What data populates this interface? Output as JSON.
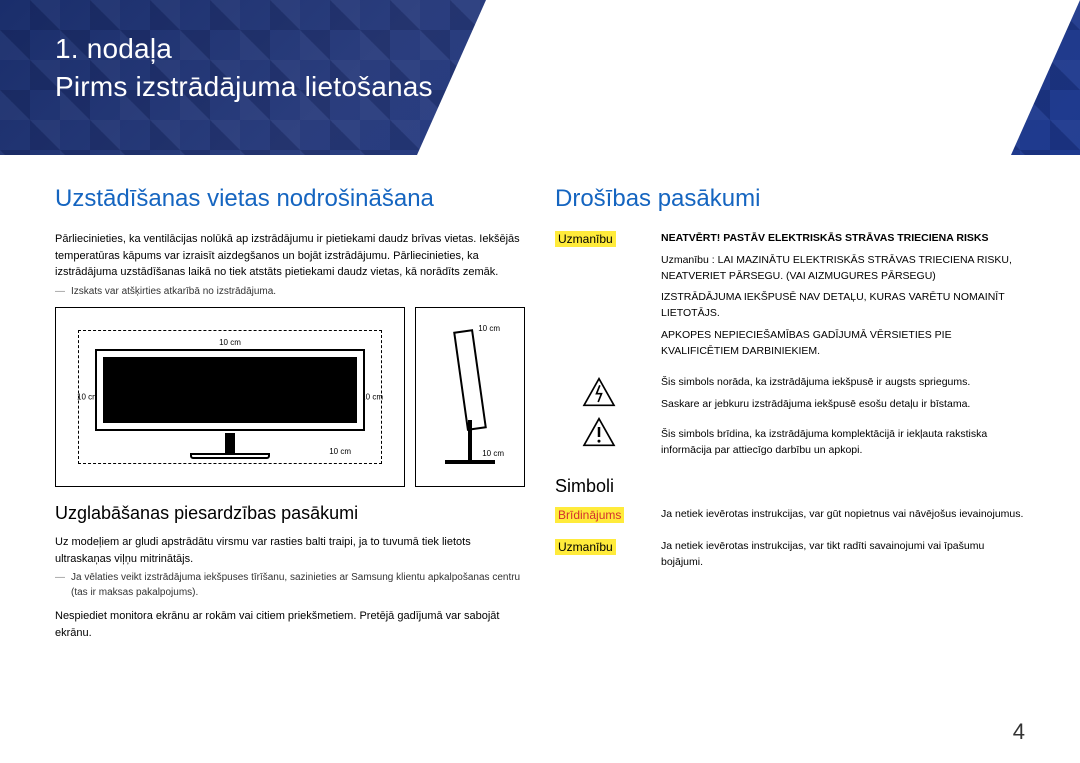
{
  "header": {
    "chapter_label": "1. nodaļa",
    "chapter_title": "Pirms izstrādājuma lietošanas"
  },
  "left": {
    "heading": "Uzstādīšanas vietas nodrošināšana",
    "intro": "Pārliecinieties, ka ventilācijas nolūkā ap izstrādājumu ir pietiekami daudz brīvas vietas. Iekšējās temperatūras kāpums var izraisīt aizdegšanos un bojāt izstrādājumu. Pārliecinieties, ka izstrādājuma uzstādīšanas laikā no tiek atstāts pietiekami daudz vietas, kā norādīts zemāk.",
    "note1": "Izskats var atšķirties atkarībā no izstrādājuma.",
    "dim_10cm": "10 cm",
    "storage_heading": "Uzglabāšanas piesardzības pasākumi",
    "storage_p1": "Uz modeļiem ar gludi apstrādātu virsmu var rasties balti traipi, ja to tuvumā tiek lietots ultraskaņas viļņu mitrinātājs.",
    "storage_note": "Ja vēlaties veikt izstrādājuma iekšpuses tīrīšanu, sazinieties ar Samsung klientu apkalpošanas centru (tas ir maksas pakalpojums).",
    "storage_p2": "Nespiediet monitora ekrānu ar rokām vai citiem priekšmetiem. Pretējā gadījumā var sabojāt ekrānu."
  },
  "right": {
    "heading": "Drošības pasākumi",
    "caution_label": "Uzmanību",
    "caution_bold": "NEATVĒRT! PASTĀV ELEKTRISKĀS STRĀVAS TRIECIENA RISKS",
    "caution_p1": "Uzmanību : LAI MAZINĀTU ELEKTRISKĀS STRĀVAS TRIECIENA RISKU, NEATVERIET PĀRSEGU. (VAI AIZMUGURES PĀRSEGU)",
    "caution_p2": "IZSTRĀDĀJUMA IEKŠPUSĒ NAV DETAĻU, KURAS VARĒTU NOMAINĪT LIETOTĀJS.",
    "caution_p3": "APKOPES NEPIECIEŠAMĪBAS GADĪJUMĀ VĒRSIETIES PIE KVALIFICĒTIEM DARBINIEKIEM.",
    "shock_p1": "Šis simbols norāda, ka izstrādājuma iekšpusē ir augsts spriegums.",
    "shock_p2": "Saskare ar jebkuru izstrādājuma iekšpusē esošu detaļu ir bīstama.",
    "excl_p1": "Šis simbols brīdina, ka izstrādājuma komplektācijā ir iekļauta rakstiska informācija par attiecīgo darbību un apkopi.",
    "symbols_heading": "Simboli",
    "warn_label": "Brīdinājums",
    "warn_text": "Ja netiek ievērotas instrukcijas, var gūt nopietnus vai nāvējošus ievainojumus.",
    "caution2_label": "Uzmanību",
    "caution2_text": "Ja netiek ievērotas instrukcijas, var tikt radīti savainojumi vai īpašumu bojājumi."
  },
  "page_number": "4"
}
